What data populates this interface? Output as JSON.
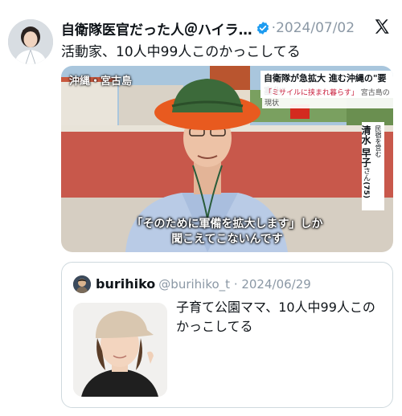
{
  "tweet": {
    "author_name": "自衛隊医官だった人＠ハイラ…",
    "date": "·2024/07/02",
    "text": "活動家、10人中99人このかっこしてる",
    "platform_icon": "x-logo-icon",
    "verified_icon": "verified-badge-icon",
    "colors": {
      "verified": "#1d9bf0",
      "secondary_text": "#8b98a5"
    }
  },
  "media": {
    "location_caption": "沖縄・宮古島",
    "headline": "自衛隊が急拡大 進む沖縄の\"要塞化\"",
    "subheadline": "「ミサイルに挟まれ暮らす」",
    "subheadline_suffix": "宮古島の現状",
    "name_label": "民宿を営む",
    "name": "清水 早子",
    "honorific": "さん",
    "age": "(75)",
    "subtitle_line1": "「そのために軍備を拡大します」しか",
    "subtitle_line2": "聞こえてこないんです"
  },
  "quote": {
    "author_name": "burihiko",
    "handle_date": "@burihiko_t · 2024/06/29",
    "text": "子育て公園ママ、10人中99人このかっこしてる"
  }
}
